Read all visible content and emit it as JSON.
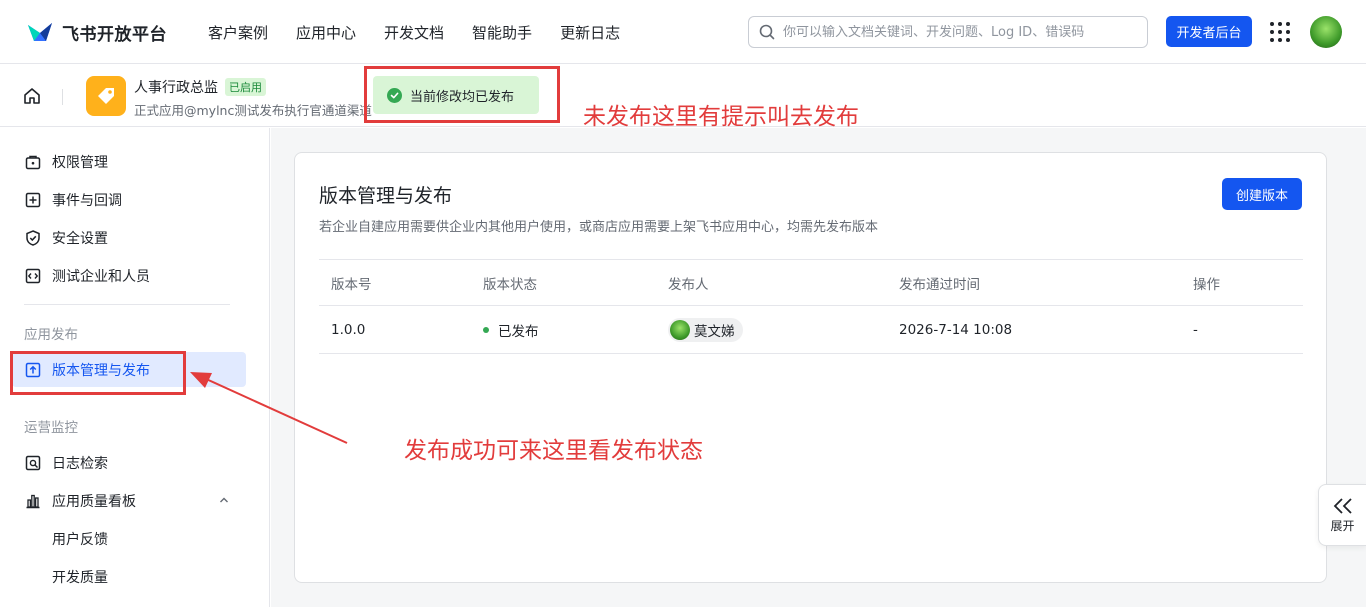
{
  "header": {
    "brand": "飞书开放平台",
    "nav": [
      "客户案例",
      "应用中心",
      "开发文档",
      "智能助手",
      "更新日志"
    ],
    "search_placeholder": "你可以输入文档关键词、开发问题、Log ID、错误码",
    "dev_console": "开发者后台"
  },
  "app": {
    "name": "人事行政总监",
    "badge": "已启用",
    "desc": "正式应用@mylnc测试发布执行官通道渠道"
  },
  "toast": {
    "text": "当前修改均已发布"
  },
  "sidebar": {
    "top_items": [
      "权限管理",
      "事件与回调",
      "安全设置",
      "测试企业和人员"
    ],
    "group_publish": "应用发布",
    "active_item": "版本管理与发布",
    "group_ops": "运营监控",
    "ops_items": [
      "日志检索",
      "应用质量看板"
    ],
    "sub_items": [
      "用户反馈",
      "开发质量"
    ]
  },
  "main": {
    "title": "版本管理与发布",
    "desc": "若企业自建应用需要供企业内其他用户使用，或商店应用需要上架飞书应用中心，均需先发布版本",
    "create_btn": "创建版本",
    "columns": [
      "版本号",
      "版本状态",
      "发布人",
      "发布通过时间",
      "操作"
    ],
    "rows": [
      {
        "version": "1.0.0",
        "status": "已发布",
        "publisher": "莫文娣",
        "time": "2026-7-14 10:08",
        "action": "-"
      }
    ]
  },
  "annotations": {
    "top": "未发布这里有提示叫去发布",
    "bottom": "发布成功可来这里看发布状态"
  },
  "expand": {
    "label": "展开"
  },
  "colors": {
    "accent": "#1456f0",
    "annotation": "#e23c3c",
    "success": "#34a853"
  }
}
